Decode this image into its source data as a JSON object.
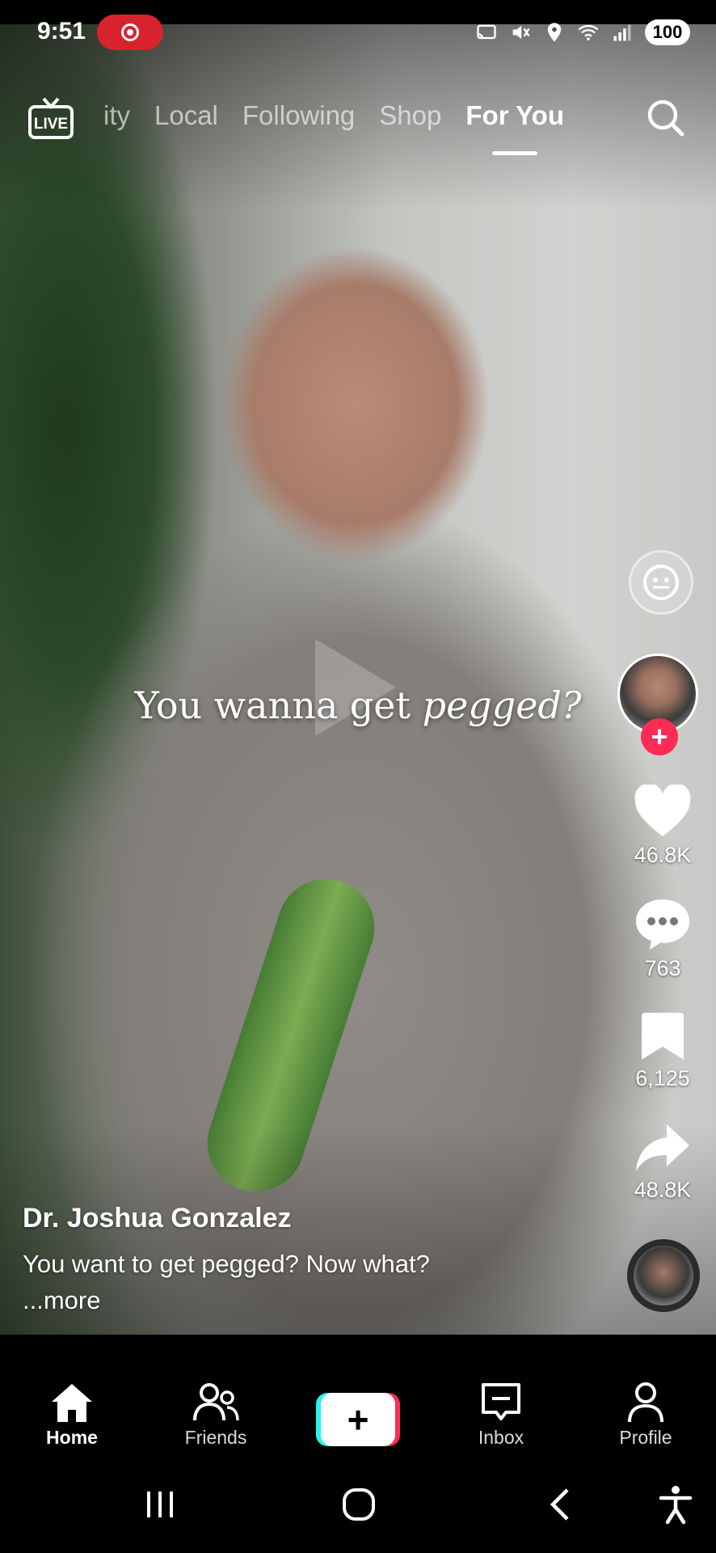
{
  "status_bar": {
    "time": "9:51",
    "battery": "100",
    "icons": [
      "screen-record-icon",
      "cast-icon",
      "mute-icon",
      "location-icon",
      "wifi-icon",
      "signal-icon"
    ]
  },
  "top_nav": {
    "tabs": [
      {
        "label": "ity",
        "active": false
      },
      {
        "label": "Local",
        "active": false
      },
      {
        "label": "Following",
        "active": false
      },
      {
        "label": "Shop",
        "active": false
      },
      {
        "label": "For You",
        "active": true
      }
    ]
  },
  "video": {
    "caption_plain": "You wanna get ",
    "caption_italic": "pegged?"
  },
  "actions": {
    "likes": "46.8K",
    "comments": "763",
    "saves": "6,125",
    "shares": "48.8K"
  },
  "creator": {
    "name": "Dr. Joshua Gonzalez",
    "description": "You want to get pegged? Now what?",
    "more": "...more"
  },
  "bottom_nav": {
    "home": "Home",
    "friends": "Friends",
    "inbox": "Inbox",
    "profile": "Profile"
  },
  "colors": {
    "accent": "#fe2c55",
    "cyan": "#25f4ee",
    "recording": "#d8232f"
  }
}
